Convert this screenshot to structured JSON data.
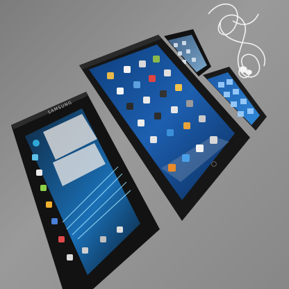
{
  "photo": {
    "surface_color": "#8f8f8f",
    "accent_colors": {
      "tablet_screen_blue": "#1d5fb0",
      "android_screen_blue": "#1a6fb5",
      "windows_phone_blue": "#2f88d8",
      "device_body": "#141414"
    }
  },
  "galaxy_tab": {
    "brand_text": "SAMSUNG"
  }
}
